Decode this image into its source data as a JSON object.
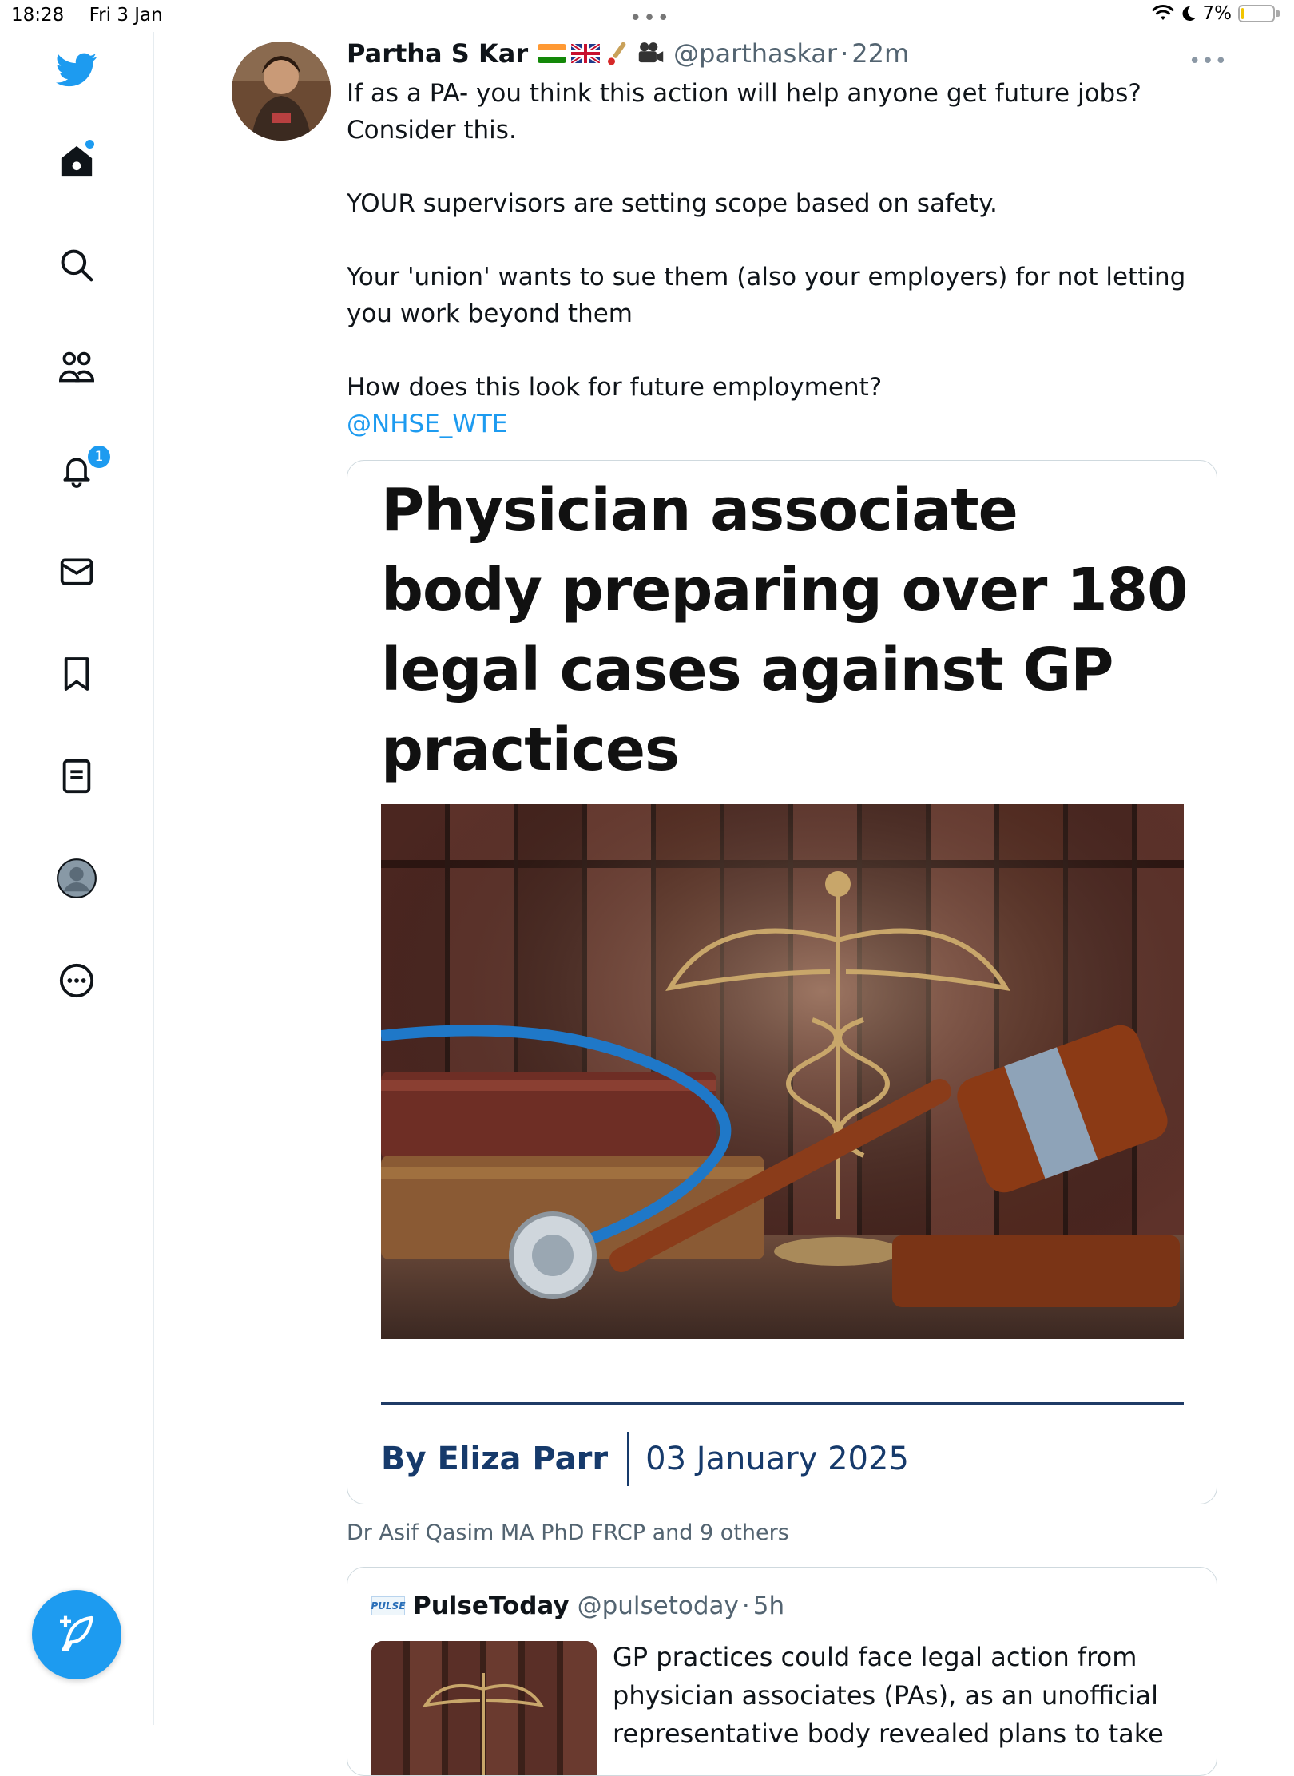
{
  "status_bar": {
    "time": "18:28",
    "date": "Fri 3 Jan",
    "battery": "7%",
    "battery_level": 0.07
  },
  "sidebar": {
    "notifications_badge": "1",
    "icons": [
      "twitter-logo-icon",
      "home-icon",
      "search-icon",
      "communities-icon",
      "bell-icon",
      "mail-icon",
      "bookmark-icon",
      "lists-icon",
      "profile-icon",
      "more-icon",
      "compose-icon"
    ]
  },
  "tweet": {
    "author_name": "Partha S Kar",
    "handle": "@parthaskar",
    "separator": "·",
    "time": "22m",
    "lines": [
      "If as a PA- you think this action will help anyone get future jobs? Consider this.",
      "YOUR supervisors are setting scope based on safety.",
      "Your 'union' wants to sue them (also your employers) for not letting you work beyond them",
      "How does this look for future employment?"
    ],
    "mention": "@NHSE_WTE"
  },
  "article": {
    "headline": "Physician associate body preparing over 180 legal cases against GP practices",
    "author": "By Eliza Parr",
    "date": "03 January 2025"
  },
  "liked_by": "Dr Asif Qasim MA PhD FRCP and 9 others",
  "quoted": {
    "logo_text": "PULSE",
    "name": "PulseToday",
    "handle": "@pulsetoday",
    "separator": "·",
    "time": "5h",
    "text": "GP practices could face legal action from physician associates (PAs), as an unofficial representative body revealed plans to take"
  },
  "colors": {
    "accent": "#1d9bf0",
    "article_blue": "#163a6b"
  }
}
